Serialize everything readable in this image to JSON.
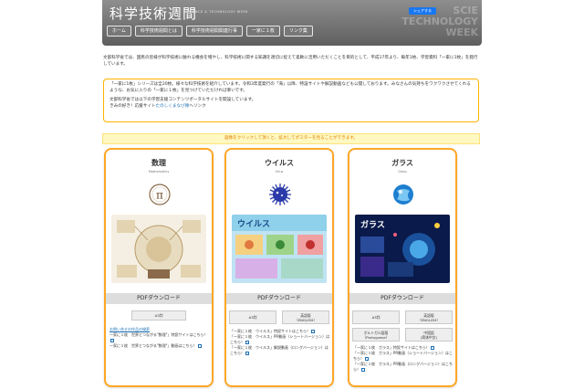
{
  "header": {
    "logo": "科学技術週間",
    "logo_sub": "SCIENCE & TECHNOLOGY WEEK",
    "watermark": [
      "SCIE",
      "TECHNOLOGY",
      "WEEK"
    ],
    "share_label": "シェアする",
    "nav": [
      "ホーム",
      "科学技術週間とは",
      "科学技術週間関連行事",
      "一家に１枚",
      "リンク集"
    ]
  },
  "intro": "文部科学省では、国民の皆様が科学技術に触れる機会を増やし、科学技術に関する知識を適切に捉えて柔軟に活用いただくことを目的として、平成17年より、毎年1枚、学習資料「一家に1枚」を発行しています。",
  "notice": {
    "p1": "「一家に1枚」シリーズは全20枚。様々な科学技術を紹介しています。令和3年度発行の「海」以降、特設サイトや解説動画なども公開しております。みなさんの気持ちをワクワクさせてくれるような、お気に入りの「一家に１枚」を見つけていただければ幸いです。",
    "p2": "文部科学省では以下の学習支援コンテンツポータルサイトを開設しています。",
    "p3_prefix": "きみの好き！応援サイト",
    "p3_link": "たのしくまなび隊",
    "p3_suffix": "へリンク"
  },
  "banner": "画像をクリックして頂くと、拡大してポスターを見ることができます。",
  "colors": {
    "accent": "#ffa726",
    "banner_bg": "#fff8c0",
    "banner_text": "#e08000",
    "link": "#1a6fb5",
    "header": "#707070"
  },
  "cards": [
    {
      "title": "数理",
      "subtitle": "Mathematics",
      "icon": "pi-icon",
      "download_label": "PDFダウンロード",
      "buttons": [
        "A3判"
      ],
      "links": [
        "お問い合せの作品の検索",
        "一家に１枚　世界とつながる\"数理\"」特設サイトはこちら！",
        "一家に１枚　世界とつながる\"数理\"」動画はこちら！"
      ]
    },
    {
      "title": "ウイルス",
      "subtitle": "Virus",
      "icon": "virus-icon",
      "download_label": "PDFダウンロード",
      "buttons": [
        "A3判",
        "英語版",
        "（ENGLISH）"
      ],
      "links": [
        "「一家に１枚　ウイルス」特設サイトはこちら！",
        "「一家に１枚　ウイルス」PR動画（ショートバージョン）はこちら！",
        "「一家に１枚　ウイルス」解説動画（ロングバージョン）はこちら！"
      ]
    },
    {
      "title": "ガラス",
      "subtitle": "Glass",
      "icon": "glass-icon",
      "download_label": "PDFダウンロード",
      "buttons": [
        "A3判",
        "英語版",
        "（ENGLISH）",
        "ポルトガル語版",
        "（Portuguese）",
        "中国語",
        "(简体中文)"
      ],
      "links": [
        "「一家に１枚　ガラス」特設サイトはこちら！",
        "「一家に１枚　ガラス」PR動画（ショートバージョン）はこちら！",
        "「一家に１枚　ガラス」PR動画（ロングバージョン）はこちら！"
      ]
    }
  ]
}
